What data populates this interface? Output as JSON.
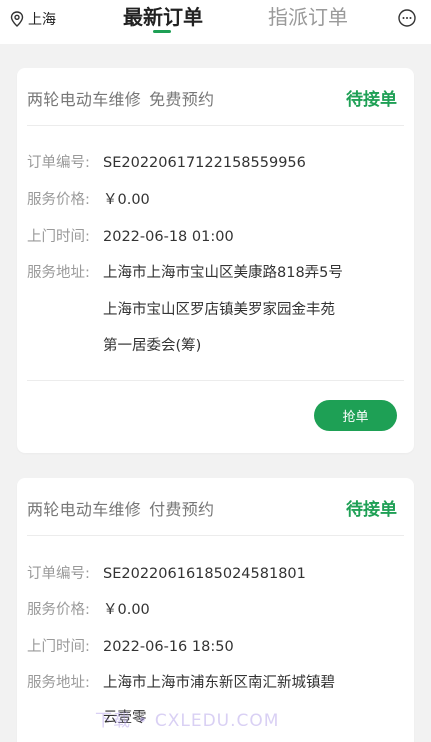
{
  "header": {
    "location": "上海",
    "tabs": [
      {
        "label": "最新订单",
        "active": true
      },
      {
        "label": "指派订单",
        "active": false
      }
    ]
  },
  "orders": [
    {
      "service": "两轮电动车维修",
      "booking_type": "免费预约",
      "status": "待接单",
      "fields": [
        {
          "label": "订单编号:",
          "value": "SE20220617122158559956"
        },
        {
          "label": "服务价格:",
          "value": "￥0.00"
        },
        {
          "label": "上门时间:",
          "value": "2022-06-18 01:00"
        },
        {
          "label": "服务地址:",
          "value": "上海市上海市宝山区美康路818弄5号"
        }
      ],
      "address_lines": [
        "上海市宝山区罗店镇美罗家园金丰苑",
        "第一居委会(筹)"
      ],
      "action_label": "抢单"
    },
    {
      "service": "两轮电动车维修",
      "booking_type": "付费预约",
      "status": "待接单",
      "fields": [
        {
          "label": "订单编号:",
          "value": "SE20220616185024581801"
        },
        {
          "label": "服务价格:",
          "value": "￥0.00"
        },
        {
          "label": "上门时间:",
          "value": "2022-06-16 18:50"
        },
        {
          "label": "服务地址:",
          "value": "上海市上海市浦东新区南汇新城镇碧"
        }
      ],
      "address_lines": [
        "云壹零"
      ]
    }
  ],
  "watermark": "下载 • CXLEDU.COM",
  "colors": {
    "accent": "#1ea055",
    "background": "#f2f2f2"
  },
  "icons": {
    "location": "location-pin-icon",
    "message": "chat-bubble-icon"
  }
}
